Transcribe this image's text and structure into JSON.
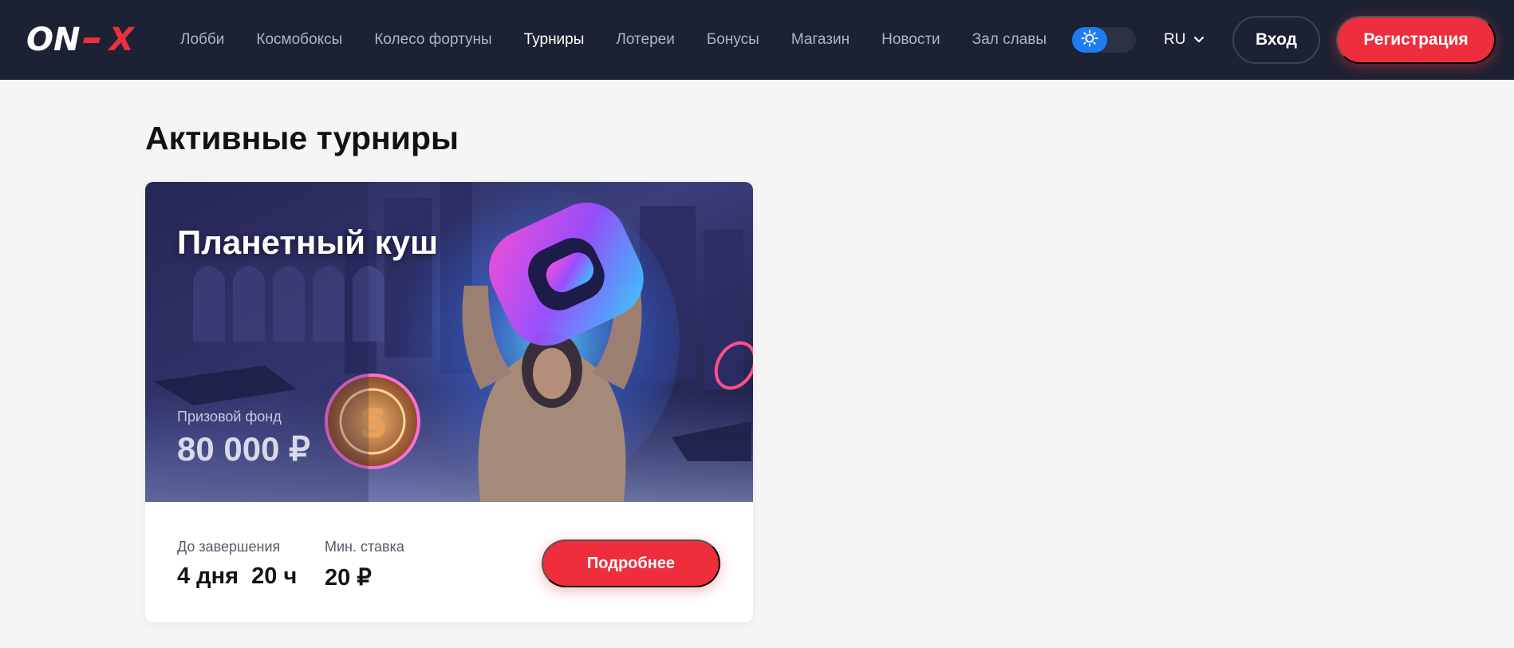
{
  "brand": {
    "logo_text": "ON-X",
    "accent": "#ee2e3d",
    "header_bg": "#1c2233"
  },
  "nav": {
    "items": [
      {
        "label": "Лобби"
      },
      {
        "label": "Космобоксы"
      },
      {
        "label": "Колесо фортуны"
      },
      {
        "label": "Турниры",
        "active": true
      },
      {
        "label": "Лотереи"
      },
      {
        "label": "Бонусы"
      },
      {
        "label": "Магазин"
      },
      {
        "label": "Новости"
      },
      {
        "label": "Зал славы"
      }
    ]
  },
  "header": {
    "theme_icon": "sun-icon",
    "language": "RU",
    "login_label": "Вход",
    "register_label": "Регистрация"
  },
  "main": {
    "title": "Активные турниры",
    "tournament": {
      "name": "Планетный куш",
      "prize_label": "Призовой фонд",
      "prize_value": "80 000 ₽",
      "ends_label": "До завершения",
      "ends_value": "4 дня  20 ч",
      "min_bet_label": "Мин. ставка",
      "min_bet_value": "20 ₽",
      "details_label": "Подробнее"
    }
  }
}
